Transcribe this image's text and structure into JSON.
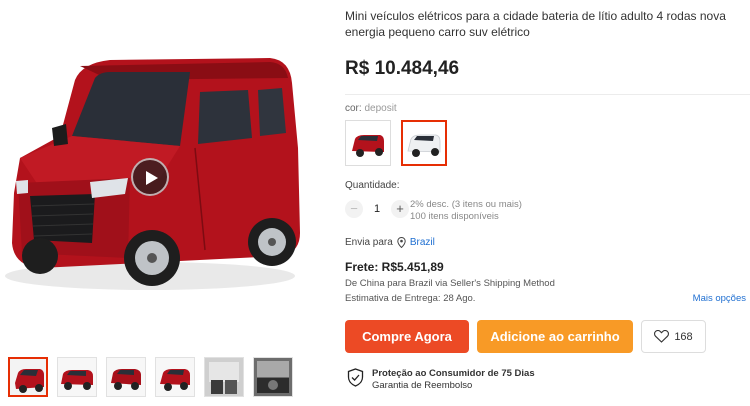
{
  "product": {
    "title": "Mini veículos elétricos para a cidade bateria de lítio adulto 4 rodas nova energia pequeno carro suv elétrico",
    "price": "R$ 10.484,46",
    "main_image_icon": "red-electric-car-image",
    "thumbnails": [
      {
        "icon": "red-car-front-image",
        "active": true
      },
      {
        "icon": "red-car-side-image",
        "active": false
      },
      {
        "icon": "red-car-rear-image",
        "active": false
      },
      {
        "icon": "red-car-angle-image",
        "active": false
      },
      {
        "icon": "car-interior-image",
        "active": false
      },
      {
        "icon": "car-dashboard-image",
        "active": false
      }
    ]
  },
  "color": {
    "label": "cor:",
    "value": "deposit",
    "options": [
      {
        "icon": "red-car-swatch",
        "active": false
      },
      {
        "icon": "white-car-swatch",
        "active": true
      }
    ]
  },
  "quantity": {
    "label": "Quantidade:",
    "minus": "−",
    "plus": "+",
    "value": "1",
    "discount": "2% desc. (3 itens ou mais)",
    "available": "100 itens disponíveis"
  },
  "shipping": {
    "ship_to_label": "Envia para",
    "country": "Brazil",
    "freight": "Frete: R$5.451,89",
    "route": "De China para Brazil via Seller's Shipping Method",
    "eta": "Estimativa de Entrega: 28 Ago.",
    "more_options": "Mais opções"
  },
  "actions": {
    "buy_now": "Compre Agora",
    "add_to_cart": "Adicione ao carrinho",
    "wishlist_count": "168"
  },
  "protection": {
    "title": "Proteção ao Consumidor de 75 Dias",
    "subtitle": "Garantia de Reembolso"
  },
  "colors": {
    "accent_red": "#e62e04",
    "buy_button": "#ec4a25",
    "cart_button": "#f89a26",
    "link_blue": "#1f6fd1",
    "car_red": "#b3121c"
  }
}
